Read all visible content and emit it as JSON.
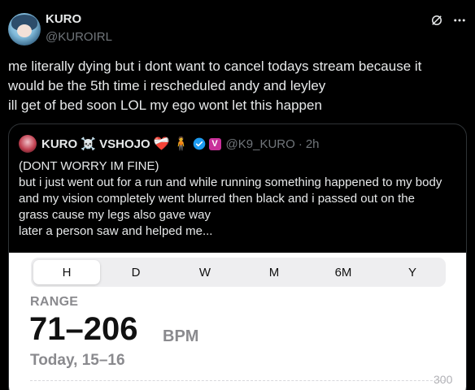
{
  "post": {
    "author_name": "KURO",
    "author_handle": "@KUROIRL",
    "text_lines": [
      "me literally dying but i dont want to cancel todays stream because it",
      "would be the 5th time i rescheduled andy and leyley",
      "ill get of bed soon LOL my ego wont let this happen"
    ]
  },
  "quote": {
    "name": "KURO ☠️ VSHOJO",
    "emojis": [
      "❤️‍🩹",
      "🧍"
    ],
    "badge_text": "V",
    "handle": "@K9_KURO",
    "separator": "·",
    "time": "2h",
    "text_lines": [
      "(DONT WORRY IM FINE)",
      "but i just went out for a run and while running something happened to my body",
      "and my vision completely went blurred then black and i passed out on the",
      "grass cause my legs also gave way",
      "later a person saw and helped me..."
    ]
  },
  "health": {
    "tabs": [
      {
        "label": "H",
        "active": true
      },
      {
        "label": "D",
        "active": false
      },
      {
        "label": "W",
        "active": false
      },
      {
        "label": "M",
        "active": false
      },
      {
        "label": "6M",
        "active": false
      },
      {
        "label": "Y",
        "active": false
      }
    ],
    "range_label": "RANGE",
    "range_value": "71–206",
    "unit": "BPM",
    "date": "Today, 15–16",
    "axis_value": "300"
  },
  "colors": {
    "background": "#000000",
    "text": "#e7e9ea",
    "muted": "#71767b",
    "verified": "#1d9bf0",
    "badge": "#c9309a"
  }
}
